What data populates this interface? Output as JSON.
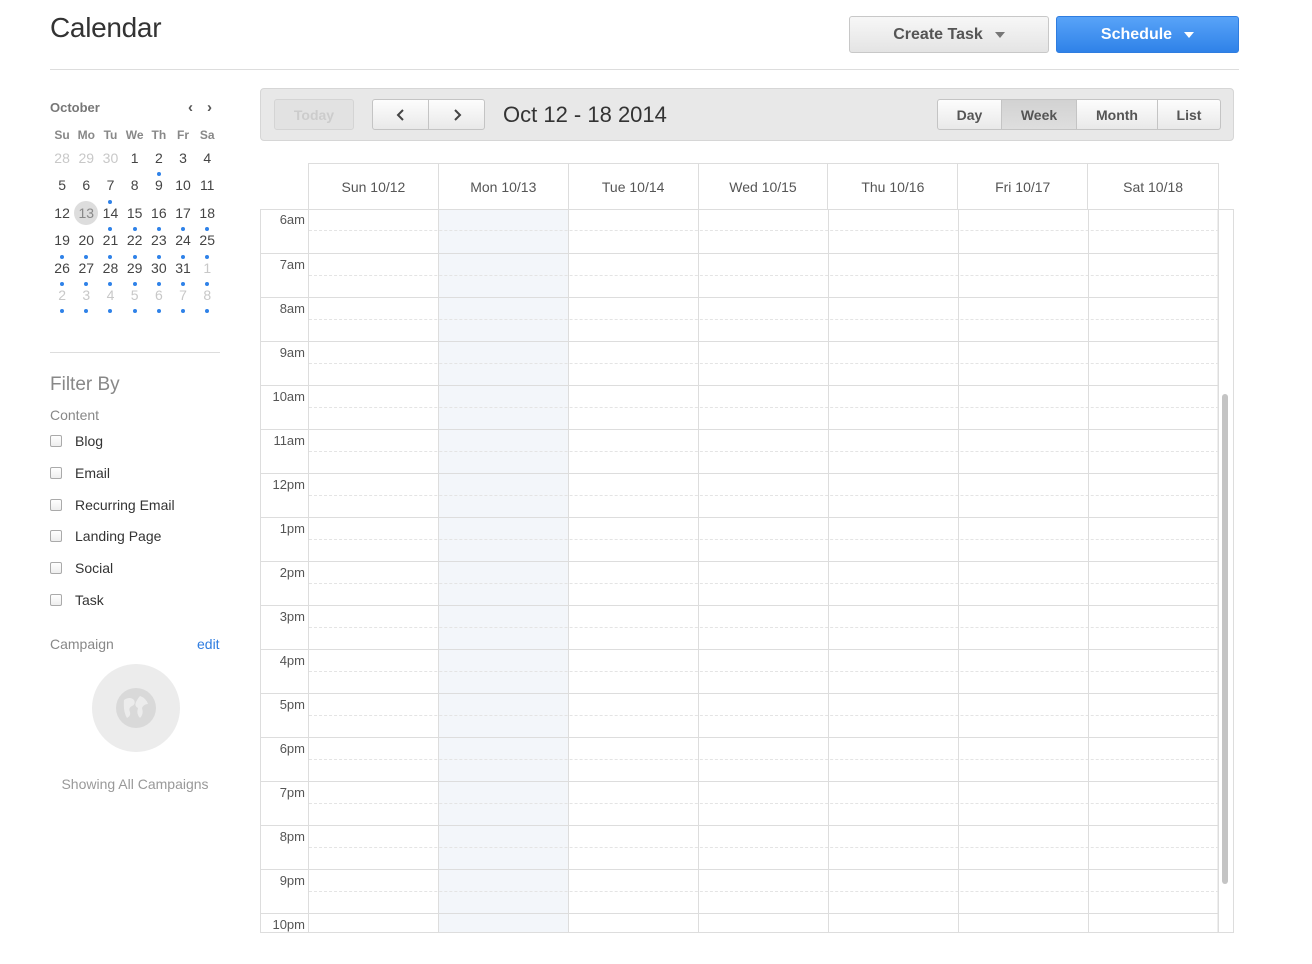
{
  "page": {
    "title": "Calendar"
  },
  "header": {
    "create_task_label": "Create Task",
    "schedule_label": "Schedule"
  },
  "mini_calendar": {
    "month": "October",
    "weekdays": [
      "Su",
      "Mo",
      "Tu",
      "We",
      "Th",
      "Fr",
      "Sa"
    ],
    "weeks": [
      [
        {
          "d": "28",
          "m": 1
        },
        {
          "d": "29",
          "m": 1
        },
        {
          "d": "30",
          "m": 1
        },
        {
          "d": "1"
        },
        {
          "d": "2",
          "dot": 1
        },
        {
          "d": "3"
        },
        {
          "d": "4"
        }
      ],
      [
        {
          "d": "5"
        },
        {
          "d": "6"
        },
        {
          "d": "7",
          "dot": 1
        },
        {
          "d": "8"
        },
        {
          "d": "9"
        },
        {
          "d": "10"
        },
        {
          "d": "11"
        }
      ],
      [
        {
          "d": "12"
        },
        {
          "d": "13",
          "today": 1
        },
        {
          "d": "14",
          "dot": 1
        },
        {
          "d": "15",
          "dot": 1
        },
        {
          "d": "16",
          "dot": 1
        },
        {
          "d": "17",
          "dot": 1
        },
        {
          "d": "18",
          "dot": 1
        }
      ],
      [
        {
          "d": "19",
          "dot": 1
        },
        {
          "d": "20",
          "dot": 1
        },
        {
          "d": "21",
          "dot": 1
        },
        {
          "d": "22",
          "dot": 1
        },
        {
          "d": "23",
          "dot": 1
        },
        {
          "d": "24",
          "dot": 1
        },
        {
          "d": "25",
          "dot": 1
        }
      ],
      [
        {
          "d": "26",
          "dot": 1
        },
        {
          "d": "27",
          "dot": 1
        },
        {
          "d": "28",
          "dot": 1
        },
        {
          "d": "29",
          "dot": 1
        },
        {
          "d": "30",
          "dot": 1
        },
        {
          "d": "31",
          "dot": 1
        },
        {
          "d": "1",
          "m": 1,
          "dot": 1
        }
      ],
      [
        {
          "d": "2",
          "m": 1,
          "dot": 1
        },
        {
          "d": "3",
          "m": 1,
          "dot": 1
        },
        {
          "d": "4",
          "m": 1,
          "dot": 1
        },
        {
          "d": "5",
          "m": 1,
          "dot": 1
        },
        {
          "d": "6",
          "m": 1,
          "dot": 1
        },
        {
          "d": "7",
          "m": 1,
          "dot": 1
        },
        {
          "d": "8",
          "m": 1,
          "dot": 1
        }
      ]
    ]
  },
  "filter": {
    "title": "Filter By",
    "content_label": "Content",
    "items": [
      "Blog",
      "Email",
      "Recurring Email",
      "Landing Page",
      "Social",
      "Task"
    ],
    "campaign_label": "Campaign",
    "edit_label": "edit",
    "showing_label": "Showing All Campaigns"
  },
  "toolbar": {
    "today_label": "Today",
    "range_title": "Oct 12 - 18 2014",
    "views": [
      "Day",
      "Week",
      "Month",
      "List"
    ],
    "active_view": "Week"
  },
  "week": {
    "days": [
      "Sun 10/12",
      "Mon 10/13",
      "Tue 10/14",
      "Wed 10/15",
      "Thu 10/16",
      "Fri 10/17",
      "Sat 10/18"
    ],
    "hours": [
      "6am",
      "7am",
      "8am",
      "9am",
      "10am",
      "11am",
      "12pm",
      "1pm",
      "2pm",
      "3pm",
      "4pm",
      "5pm",
      "6pm",
      "7pm",
      "8pm",
      "9pm",
      "10pm"
    ]
  }
}
